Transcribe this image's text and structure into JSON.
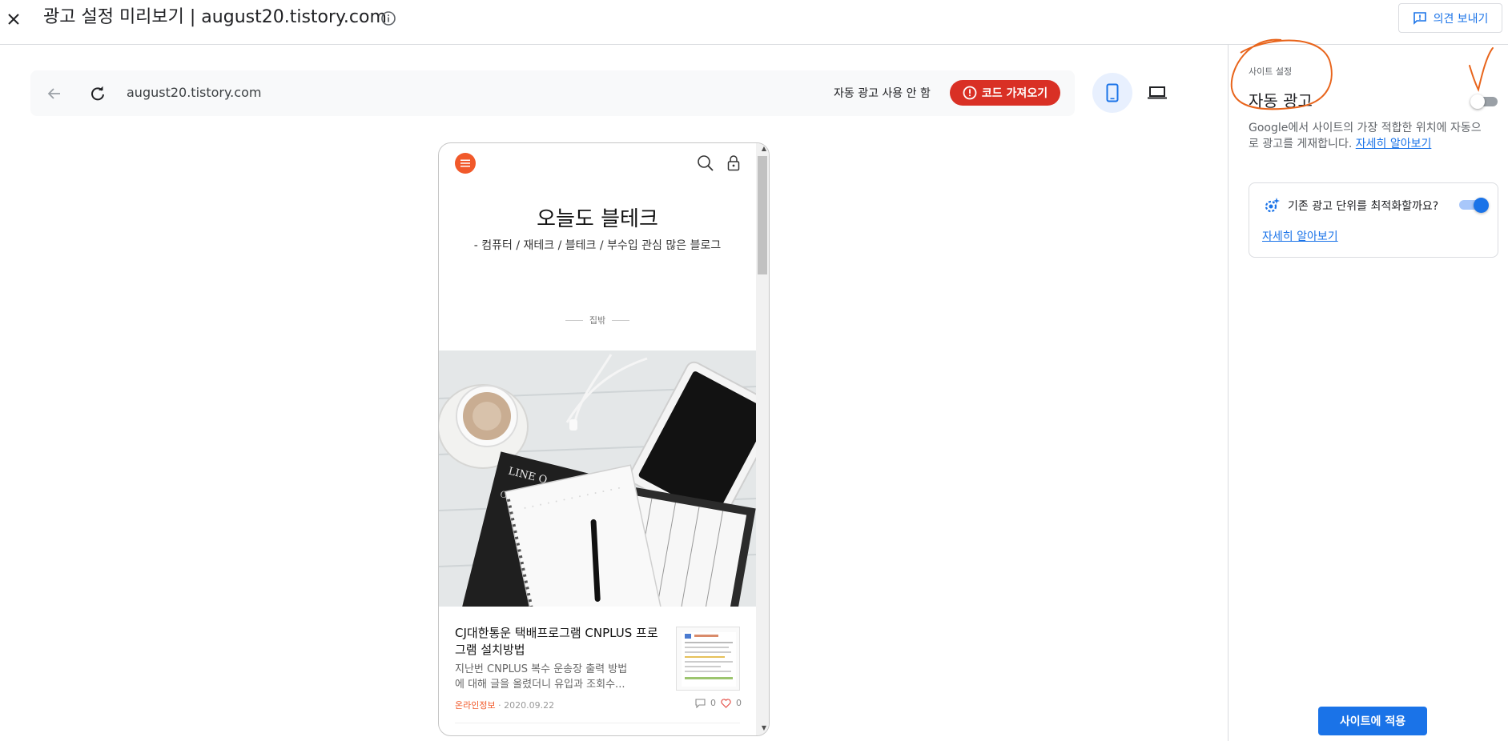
{
  "header": {
    "close_icon": "close-icon",
    "title": "광고 설정 미리보기 | august20.tistory.com",
    "info_icon": "info-icon",
    "feedback_label": "의견 보내기"
  },
  "browser_bar": {
    "url": "august20.tistory.com",
    "autoads_status": "자동 광고 사용 안 함",
    "get_code_label": "코드 가져오기"
  },
  "device_toggle": {
    "selected": "mobile"
  },
  "blog": {
    "title": "오늘도 블테크",
    "description": "- 컴퓨터 / 재테크 / 블테크 / 부수입 관심 많은 블로그",
    "category": "집밖",
    "post": {
      "title": "CJ대한통운 택배프로그램 CNPLUS 프로그램 설치방법",
      "excerpt": "지난번 CNPLUS 복수 운송장 출력 방법\n에 대해 글을 올렸더니 유입과 조회수...",
      "category": "온라인정보",
      "date": "· 2020.09.22",
      "comments": "0",
      "likes": "0"
    }
  },
  "side_panel": {
    "section_label": "사이트 설정",
    "autoads_label": "자동 광고",
    "autoads_enabled": false,
    "description": "Google에서 사이트의 가장 적합한 위치에 자동으로 광고를 게재합니다.",
    "learn_more": "자세히 알아보기",
    "optimize": {
      "question": "기존 광고 단위를 최적화할까요?",
      "enabled": true,
      "learn_more": "자세히 알아보기"
    },
    "apply_label": "사이트에 적용"
  },
  "colors": {
    "accent": "#1a73e8",
    "danger": "#d93025",
    "blog_accent": "#f1592a",
    "annotation": "#e8641b"
  }
}
